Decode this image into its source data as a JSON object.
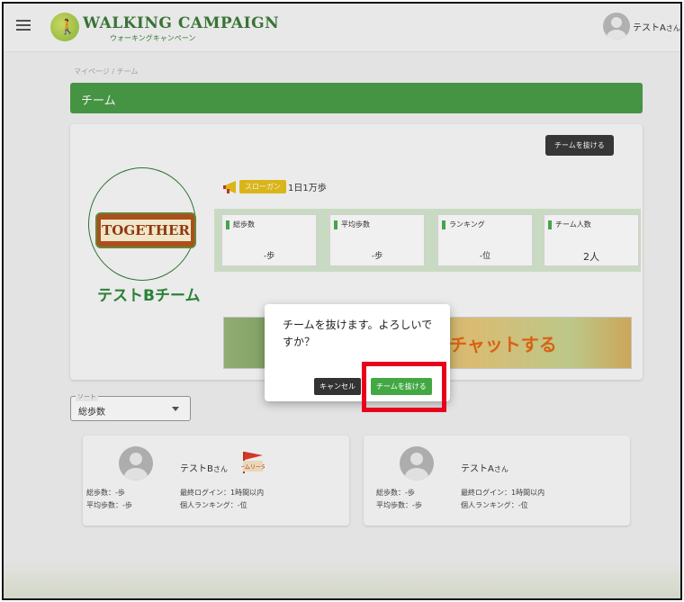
{
  "header": {
    "logo_title": "WALKING CAMPAIGN",
    "logo_subtitle": "ウォーキングキャンペーン",
    "user_name": "テストA",
    "user_suffix": "さん"
  },
  "breadcrumb": "マイページ / チーム",
  "page_title": "チーム",
  "team": {
    "leave_button": "チームを抜ける",
    "logo_text": "TOGETHER",
    "name": "テストBチーム",
    "slogan_badge": "スローガン",
    "slogan": "1日1万歩",
    "stats": [
      {
        "label": "総歩数",
        "value": "-歩"
      },
      {
        "label": "平均歩数",
        "value": "-歩"
      },
      {
        "label": "ランキング",
        "value": "-位"
      },
      {
        "label": "チーム人数",
        "value": "2人"
      }
    ],
    "chat_banner": "チャットする"
  },
  "sort": {
    "label": "ソート",
    "value": "総歩数"
  },
  "members": [
    {
      "name": "テストB",
      "suffix": "さん",
      "total_steps": "総歩数：-歩",
      "avg_steps": "平均歩数：-歩",
      "last_login": "最終ログイン：1時間以内",
      "ranking": "個人ランキング：-位",
      "badge": "チームリーダー"
    },
    {
      "name": "テストA",
      "suffix": "さん",
      "total_steps": "総歩数：-歩",
      "avg_steps": "平均歩数：-歩",
      "last_login": "最終ログイン：1時間以内",
      "ranking": "個人ランキング：-位"
    }
  ],
  "dialog": {
    "message": "チームを抜けます。よろしいですか？",
    "cancel": "キャンセル",
    "confirm": "チームを抜ける"
  },
  "colors": {
    "brand_green": "#4a9e48",
    "highlight_red": "#e8001c",
    "confirm_green": "#43a843"
  }
}
